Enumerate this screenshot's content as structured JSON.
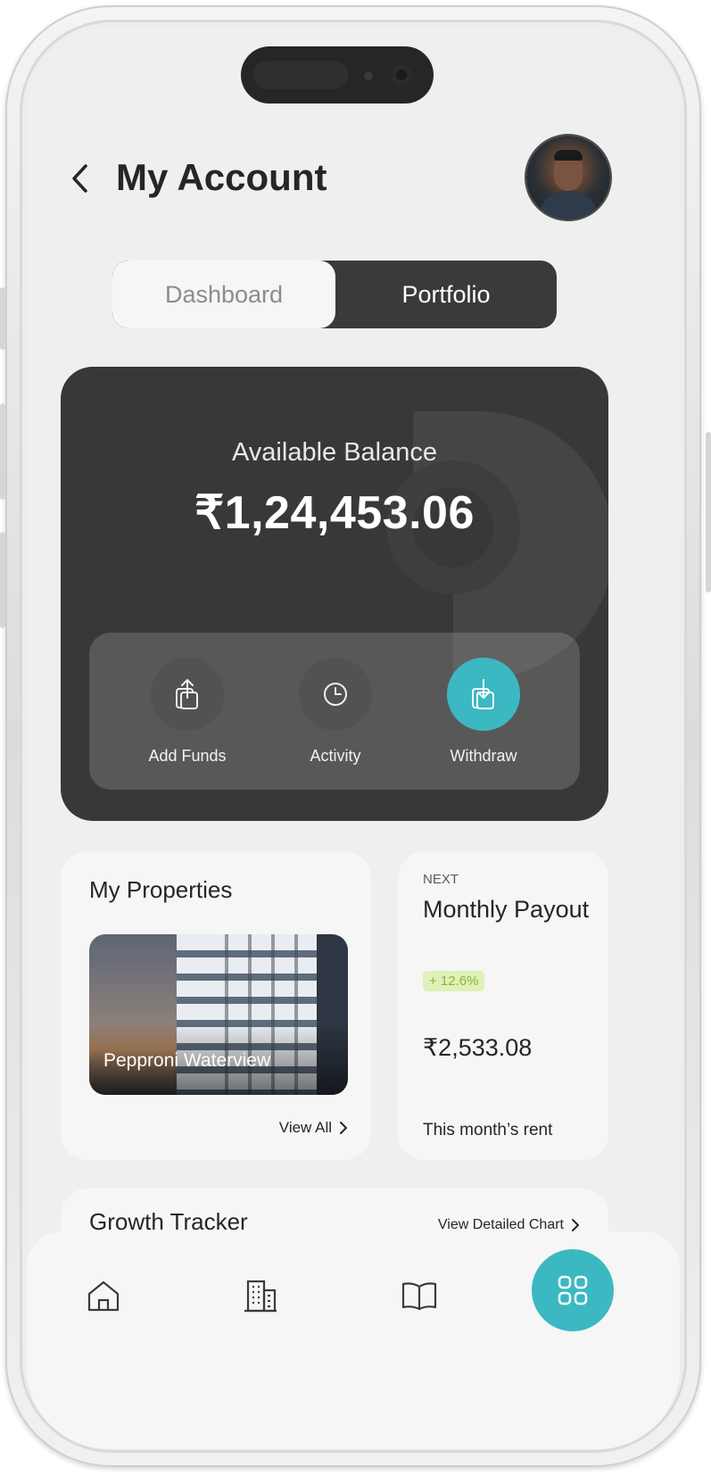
{
  "header": {
    "title": "My Account",
    "back_icon": "chevron-left-icon",
    "avatar_icon": "user-avatar"
  },
  "tabs": [
    {
      "label": "Dashboard",
      "selected": false
    },
    {
      "label": "Portfolio",
      "selected": true
    }
  ],
  "balance": {
    "label": "Available Balance",
    "amount": "₹1,24,453.06"
  },
  "actions": [
    {
      "label": "Add Funds",
      "icon": "upload-icon"
    },
    {
      "label": "Activity",
      "icon": "clock-icon"
    },
    {
      "label": "Withdraw",
      "icon": "download-icon"
    }
  ],
  "properties": {
    "heading": "My Properties",
    "property_name": "Pepproni Waterview",
    "view_all": "View All"
  },
  "payout": {
    "eyebrow": "NEXT",
    "title": "Monthly Payout",
    "change": "+ 12.6%",
    "amount": "₹2,533.08",
    "caption": "This month’s rent"
  },
  "growth": {
    "heading": "Growth Tracker",
    "link": "View Detailed Chart"
  },
  "nav": {
    "items": [
      "home-icon",
      "building-icon",
      "book-icon",
      "grid-icon"
    ],
    "active": "grid-icon"
  },
  "colors": {
    "accent": "#3bb8c2",
    "dark_card": "#383838",
    "badge_bg": "#dff0b9",
    "badge_text": "#8ab53a"
  }
}
